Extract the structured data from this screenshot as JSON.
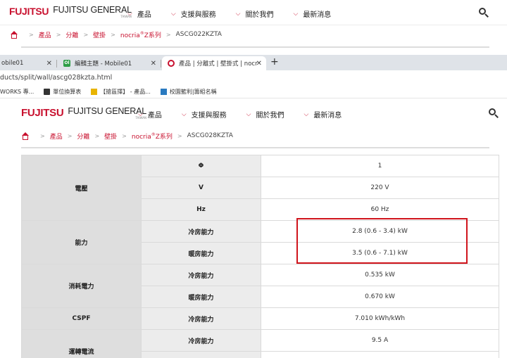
{
  "brand": {
    "name": "FUJITSU",
    "full": "FUJITSU GENERAL",
    "region": "TAIWAN"
  },
  "nav": [
    "產品",
    "支援與服務",
    "關於我們",
    "最新消息"
  ],
  "crumb_top": {
    "items": [
      "產品",
      "分離",
      "壁掛"
    ],
    "series": "nocria",
    "series_sup": "®",
    "series_tail": "Z系列",
    "current": "ASCG022KZTA"
  },
  "tabs": [
    {
      "label": "obile01"
    },
    {
      "label": "編輯主題 - Mobile01",
      "icon": "Ol"
    },
    {
      "label": "產品 | 分離式 | 壁掛式 | nocria®Z..."
    }
  ],
  "url": "ducts/split/wall/ascg028kzta.html",
  "bookmarks": [
    "WORKS 專...",
    "單位換算表",
    "【搶區擇】 - 產品...",
    "校園籃利|籌組名稱"
  ],
  "crumb_bottom": {
    "items": [
      "產品",
      "分離",
      "壁掛"
    ],
    "series": "nocria",
    "series_sup": "®",
    "series_tail": "Z系列",
    "current": "ASCG028KZTA"
  },
  "spec": {
    "voltage": {
      "group": "電壓",
      "rows": [
        {
          "k": "Φ",
          "v": "1"
        },
        {
          "k": "V",
          "v": "220 V"
        },
        {
          "k": "Hz",
          "v": "60 Hz"
        }
      ]
    },
    "capacity": {
      "group": "能力",
      "rows": [
        {
          "k": "冷房能力",
          "v": "2.8 (0.6 - 3.4) kW"
        },
        {
          "k": "暖房能力",
          "v": "3.5 (0.6 - 7.1) kW"
        }
      ]
    },
    "power": {
      "group": "消耗電力",
      "rows": [
        {
          "k": "冷房能力",
          "v": "0.535 kW"
        },
        {
          "k": "暖房能力",
          "v": "0.670 kW"
        }
      ]
    },
    "cspf": {
      "group": "CSPF",
      "rows": [
        {
          "k": "冷房能力",
          "v": "7.010 kWh/kWh"
        }
      ]
    },
    "current": {
      "group": "運轉電流",
      "rows": [
        {
          "k": "冷房能力",
          "v": "9.5 A"
        },
        {
          "k": "",
          "v": ""
        }
      ]
    }
  },
  "colors": {
    "brand_red": "#c8102e",
    "highlight_box": "#d0141c",
    "group_bg": "#dedede",
    "sub_bg": "#ececec"
  }
}
